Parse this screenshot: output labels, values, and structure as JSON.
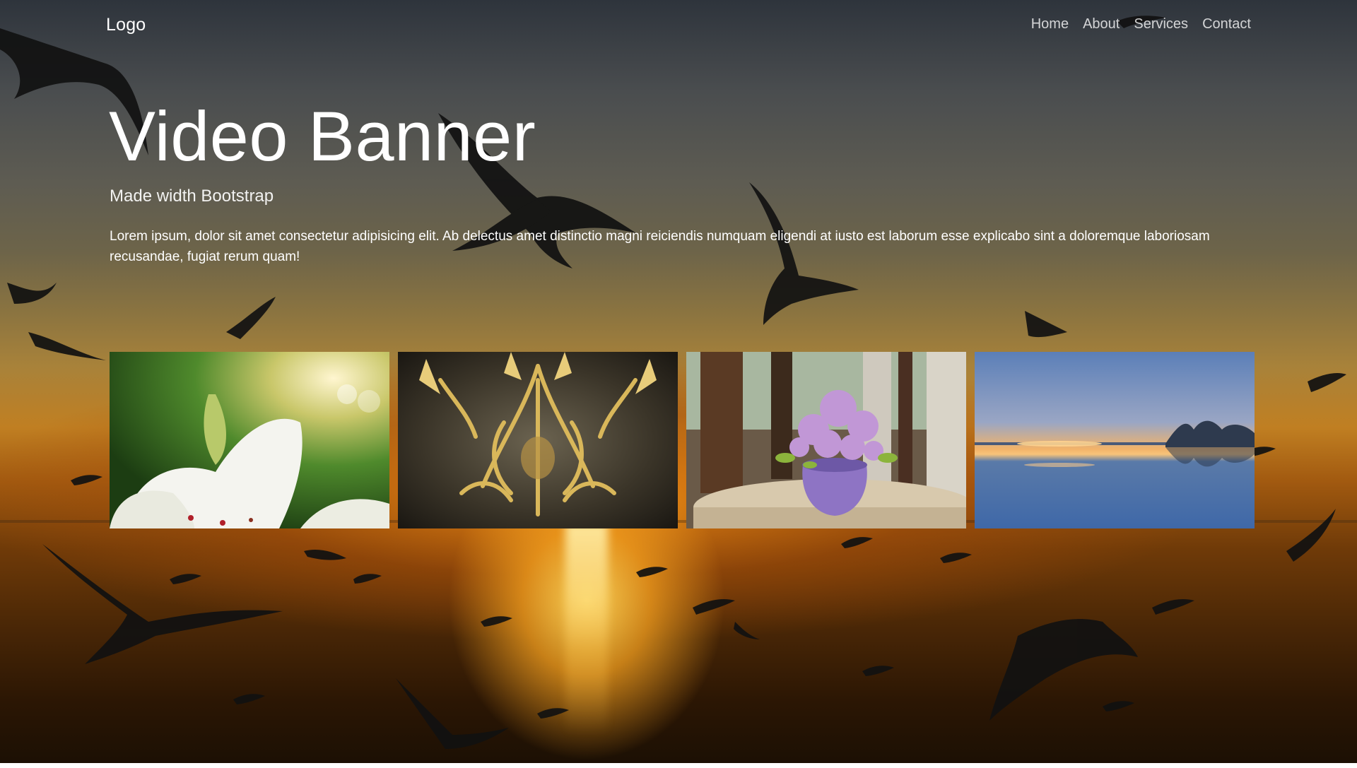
{
  "navbar": {
    "logo": "Logo",
    "links": [
      {
        "label": "Home"
      },
      {
        "label": "About"
      },
      {
        "label": "Services"
      },
      {
        "label": "Contact"
      }
    ]
  },
  "hero": {
    "title": "Video Banner",
    "subtitle": "Made width Bootstrap",
    "text": "Lorem ipsum, dolor sit amet consectetur adipisicing elit. Ab delectus amet distinctio magni reiciendis numquam eligendi at iusto est laborum esse explicabo sint a doloremque laboriosam recusandae, fugiat rerum quam!"
  },
  "gallery": {
    "images": [
      {
        "subject": "white lily"
      },
      {
        "subject": "gold ornate armor"
      },
      {
        "subject": "lilac flowers in vase"
      },
      {
        "subject": "lake at sunset"
      }
    ]
  }
}
